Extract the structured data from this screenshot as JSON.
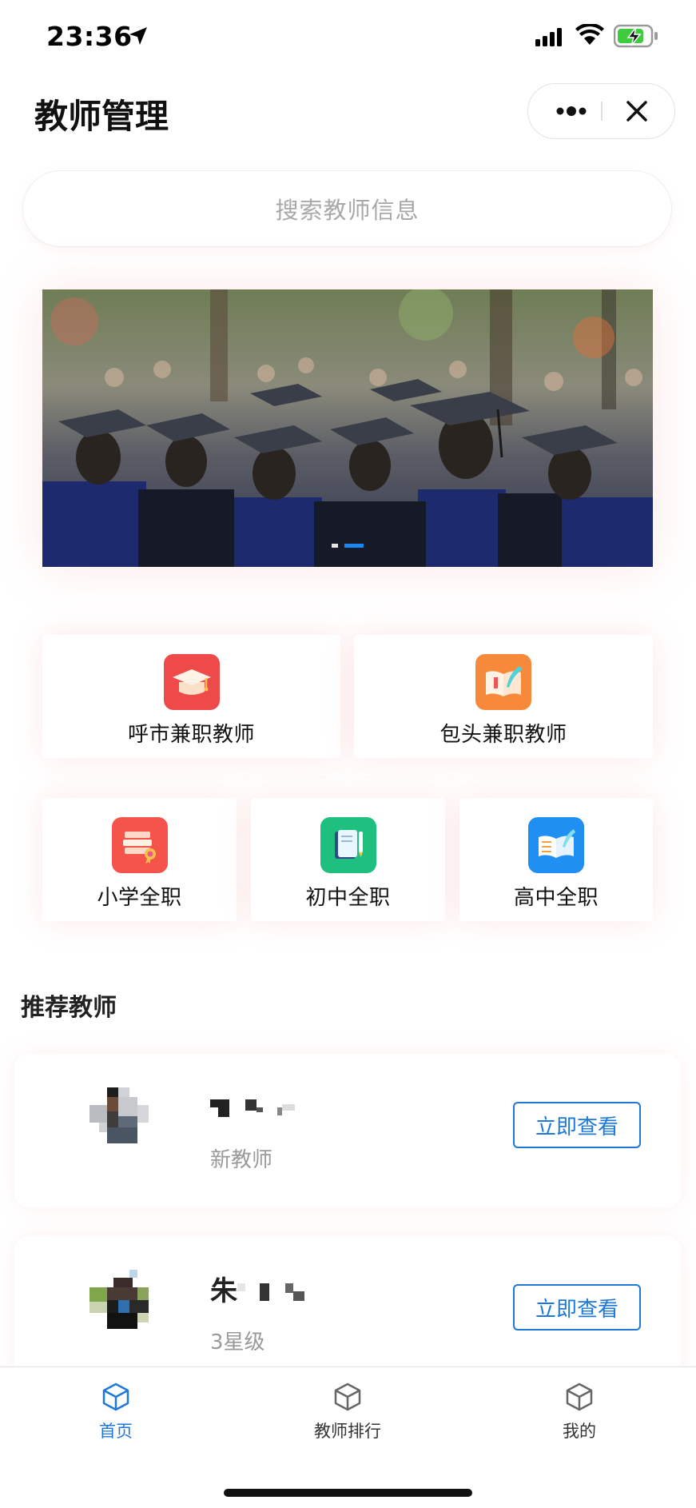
{
  "status_bar": {
    "time": "23:36"
  },
  "nav": {
    "title": "教师管理",
    "more_icon": "more-dots-icon",
    "close_icon": "close-icon"
  },
  "search": {
    "placeholder": "搜索教师信息"
  },
  "banner": {
    "dot_count": 2,
    "active_dot": 2
  },
  "categories_top": [
    {
      "label": "呼市兼职教师",
      "icon": "graduation-cap-icon",
      "color": "#ef4a4a"
    },
    {
      "label": "包头兼职教师",
      "icon": "open-book-quill-icon",
      "color": "#f6893a"
    }
  ],
  "categories_bottom": [
    {
      "label": "小学全职",
      "icon": "certificate-books-icon",
      "color": "#f4544a"
    },
    {
      "label": "初中全职",
      "icon": "notebook-pen-icon",
      "color": "#1fbf7f"
    },
    {
      "label": "高中全职",
      "icon": "book-feather-icon",
      "color": "#1f8ff2"
    }
  ],
  "section": {
    "title": "推荐教师"
  },
  "teachers": [
    {
      "name_visible": "",
      "level": "新教师",
      "action": "立即查看"
    },
    {
      "name_visible": "朱",
      "level": "3星级",
      "action": "立即查看"
    }
  ],
  "tabbar": {
    "items": [
      {
        "label": "首页",
        "icon": "cube-icon",
        "active": true
      },
      {
        "label": "教师排行",
        "icon": "cube-icon",
        "active": false
      },
      {
        "label": "我的",
        "icon": "cube-icon",
        "active": false
      }
    ]
  },
  "colors": {
    "accent": "#1e78d8",
    "card_glow": "#f07878"
  }
}
